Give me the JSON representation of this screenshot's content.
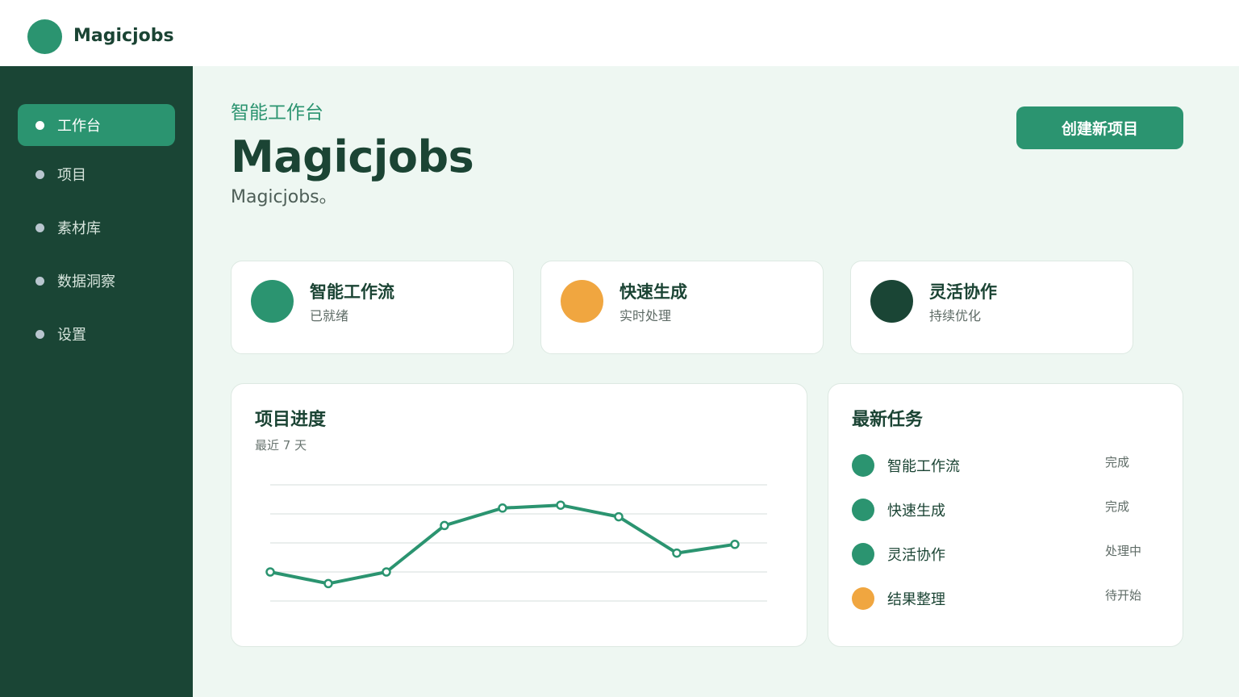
{
  "app": {
    "brand": "Magicjobs"
  },
  "sidebar": {
    "items": [
      {
        "label": "工作台",
        "active": true
      },
      {
        "label": "项目",
        "active": false
      },
      {
        "label": "素材库",
        "active": false
      },
      {
        "label": "数据洞察",
        "active": false
      },
      {
        "label": "设置",
        "active": false
      }
    ]
  },
  "header": {
    "eyebrow": "智能工作台",
    "title": "Magicjobs",
    "subtitle": "Magicjobs。",
    "create_label": "创建新项目"
  },
  "stats": [
    {
      "title": "智能工作流",
      "subtitle": "已就绪",
      "color": "#2b9470"
    },
    {
      "title": "快速生成",
      "subtitle": "实时处理",
      "color": "#f0a640"
    },
    {
      "title": "灵活协作",
      "subtitle": "持续优化",
      "color": "#1a4535"
    }
  ],
  "progress": {
    "title": "项目进度",
    "subtitle": "最近 7 天"
  },
  "chart_data": {
    "type": "line",
    "title": "项目进度",
    "subtitle": "最近 7 天",
    "xlabel": "",
    "ylabel": "",
    "ylim": [
      0,
      4
    ],
    "grid": true,
    "line_color": "#2b9470",
    "series": [
      {
        "values": [
          1.0,
          0.6,
          1.0,
          2.6,
          3.2,
          3.3,
          2.9,
          1.65,
          1.95
        ]
      }
    ]
  },
  "tasks": {
    "title": "最新任务",
    "items": [
      {
        "name": "智能工作流",
        "status": "完成",
        "color": "#2b9470"
      },
      {
        "name": "快速生成",
        "status": "完成",
        "color": "#2b9470"
      },
      {
        "name": "灵活协作",
        "status": "处理中",
        "color": "#2b9470"
      },
      {
        "name": "结果整理",
        "status": "待开始",
        "color": "#f0a640"
      }
    ]
  },
  "colors": {
    "primary": "#2b9470",
    "dark": "#1a4535",
    "accent": "#f0a640",
    "background": "#eef7f2"
  }
}
